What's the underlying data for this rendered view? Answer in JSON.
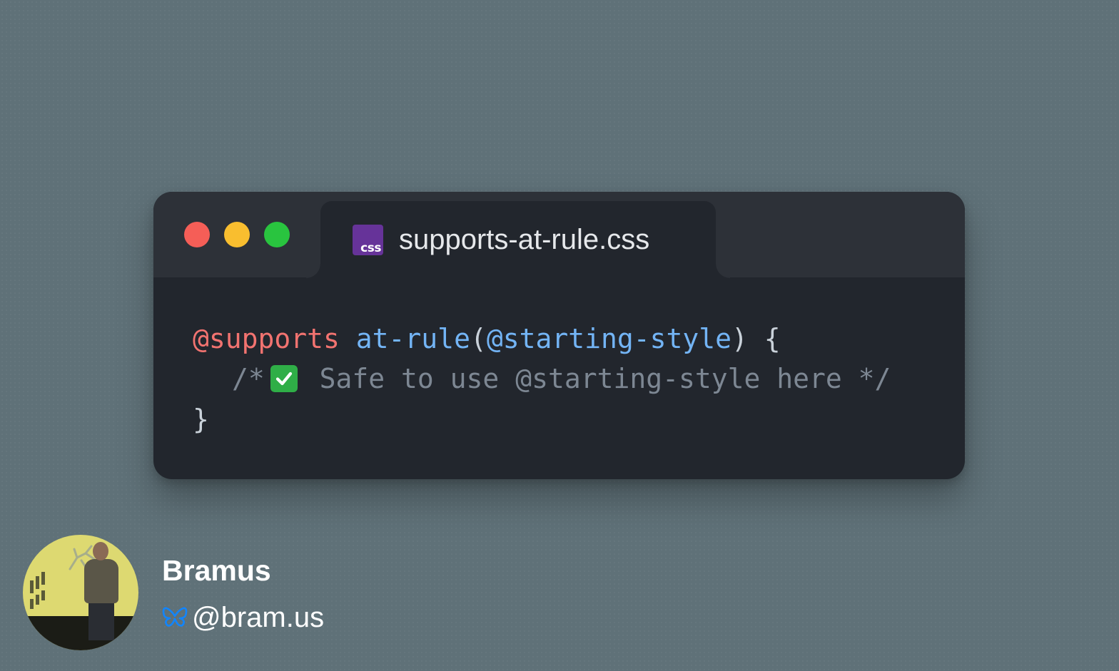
{
  "window": {
    "tab": {
      "icon": "css-file-icon",
      "icon_text": "css",
      "filename": "supports-at-rule.css"
    },
    "controls": [
      "close",
      "minimize",
      "maximize"
    ],
    "code": {
      "line1": {
        "keyword": "@supports",
        "function": "at-rule",
        "paren_open": "(",
        "argument": "@starting-style",
        "paren_close": ")",
        "brace": " {"
      },
      "line2": {
        "comment_open": "/*",
        "emoji": "check-mark-button-icon",
        "comment_text": "Safe to use @starting-style here */"
      },
      "line3": {
        "brace": "}"
      }
    }
  },
  "author": {
    "name": "Bramus",
    "handle": "@bram.us",
    "social_icon": "bluesky-butterfly-icon"
  },
  "colors": {
    "background": "#5f7178",
    "window": "#22262d",
    "titlebar": "#2d3138",
    "close": "#f55e57",
    "minimize": "#f9be2f",
    "maximize": "#29c43f",
    "css_badge": "#663399",
    "keyword": "#f27370",
    "function": "#73b4f5",
    "comment": "#7d8793",
    "bluesky": "#1185fe"
  }
}
